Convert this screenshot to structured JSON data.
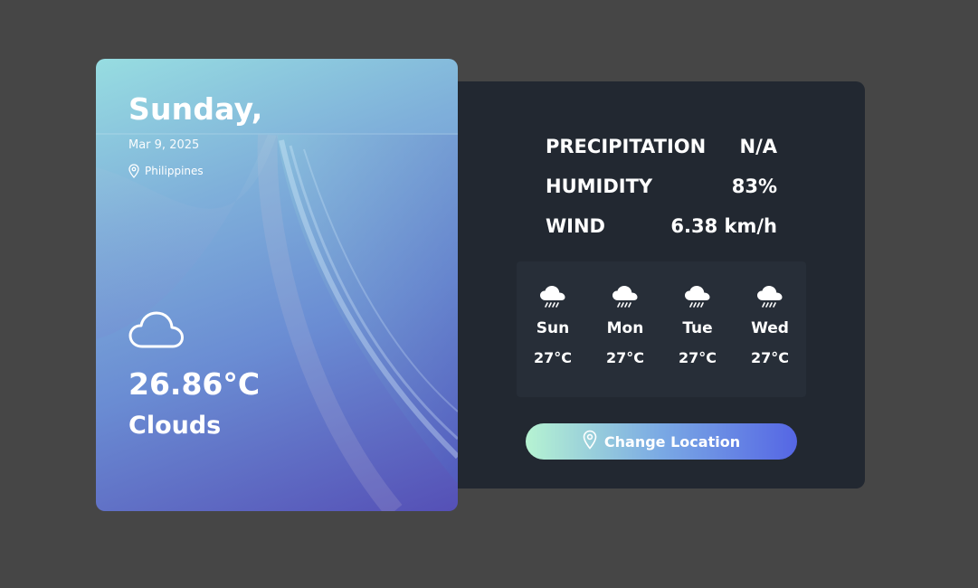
{
  "current": {
    "day": "Sunday,",
    "date": "Mar 9, 2025",
    "location": "Philippines",
    "icon": "cloud-icon",
    "temperature": "26.86°C",
    "description": "Clouds"
  },
  "stats": [
    {
      "label": "PRECIPITATION",
      "value": "N/A"
    },
    {
      "label": "HUMIDITY",
      "value": "83%"
    },
    {
      "label": "WIND",
      "value": "6.38 km/h"
    }
  ],
  "forecast": [
    {
      "day": "Sun",
      "temp": "27°C",
      "icon": "rain-cloud-icon"
    },
    {
      "day": "Mon",
      "temp": "27°C",
      "icon": "rain-cloud-icon"
    },
    {
      "day": "Tue",
      "temp": "27°C",
      "icon": "rain-cloud-icon"
    },
    {
      "day": "Wed",
      "temp": "27°C",
      "icon": "rain-cloud-icon"
    }
  ],
  "button": {
    "label": "Change Location",
    "icon": "map-pin-icon"
  },
  "colors": {
    "background": "#464646",
    "panel": "#222831",
    "forecast_panel": "#272e38",
    "button_gradient_start": "#b6f3d2",
    "button_gradient_end": "#5566e4"
  }
}
